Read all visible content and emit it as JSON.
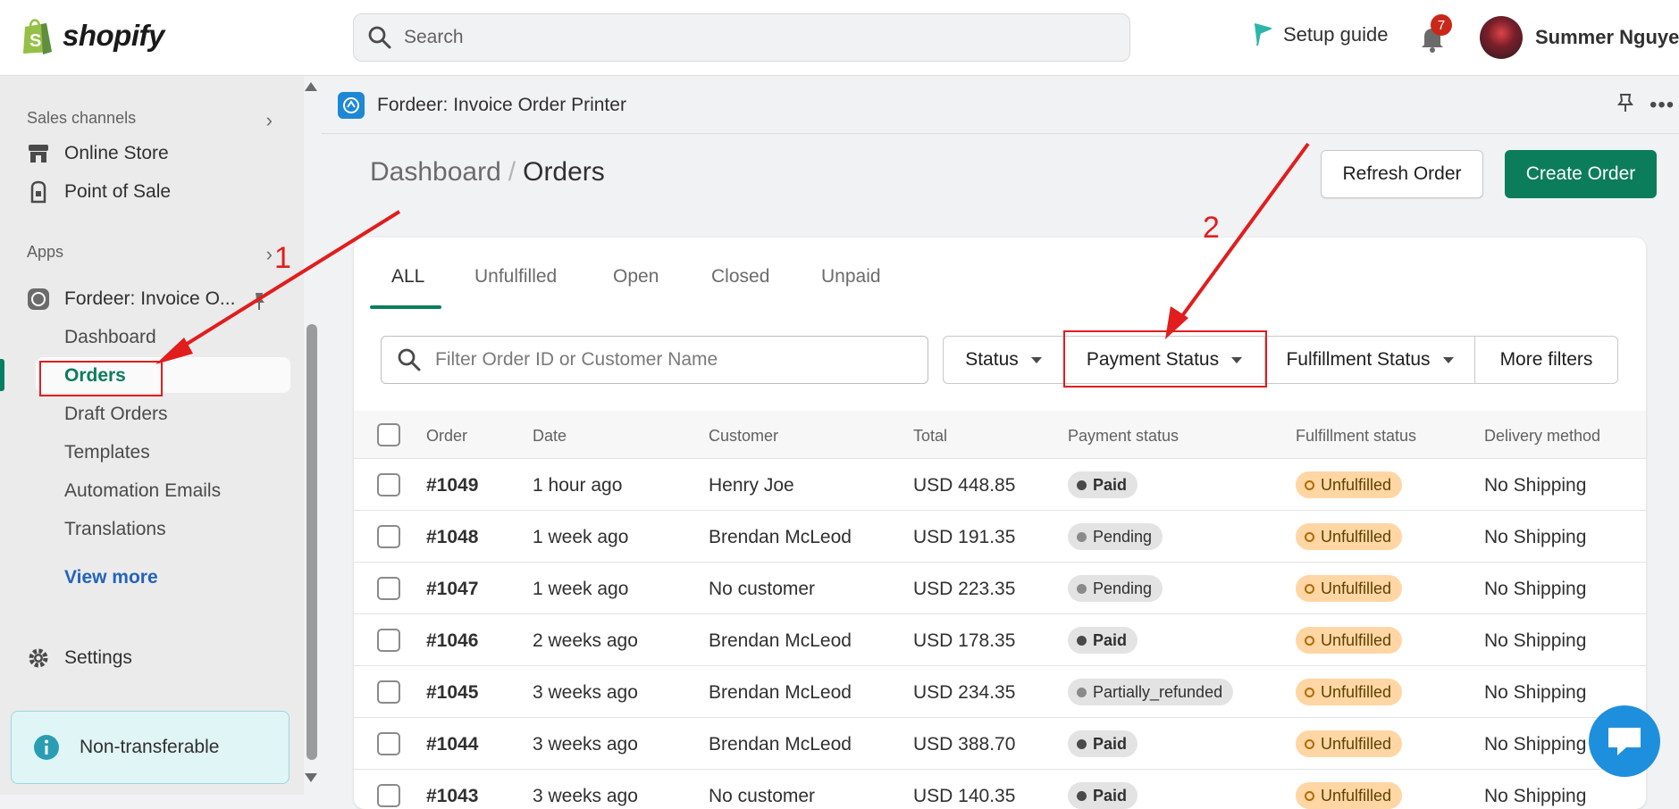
{
  "topbar": {
    "brand": "shopify",
    "search_placeholder": "Search",
    "setup_guide": "Setup guide",
    "notification_count": "7",
    "user_name": "Summer Nguyen"
  },
  "sidebar": {
    "sales_channels": "Sales channels",
    "online_store": "Online Store",
    "point_of_sale": "Point of Sale",
    "apps": "Apps",
    "app_name": "Fordeer: Invoice O...",
    "sub_items": [
      "Dashboard",
      "Orders",
      "Draft Orders",
      "Templates",
      "Automation Emails",
      "Translations"
    ],
    "view_more": "View more",
    "settings": "Settings",
    "banner": "Non-transferable"
  },
  "app": {
    "title": "Fordeer: Invoice Order Printer",
    "breadcrumb_parent": "Dashboard",
    "breadcrumb_sep": "/",
    "page_title": "Orders",
    "refresh_button": "Refresh Order",
    "create_button": "Create Order"
  },
  "tabs": [
    "ALL",
    "Unfulfilled",
    "Open",
    "Closed",
    "Unpaid"
  ],
  "filters": {
    "search_placeholder": "Filter Order ID or Customer Name",
    "status": "Status",
    "payment_status": "Payment Status",
    "fulfillment_status": "Fulfillment Status",
    "more_filters": "More filters"
  },
  "table": {
    "columns": [
      "Order",
      "Date",
      "Customer",
      "Total",
      "Payment status",
      "Fulfillment status",
      "Delivery method"
    ],
    "rows": [
      {
        "order": "#1049",
        "date": "1 hour ago",
        "customer": "Henry Joe",
        "total": "USD 448.85",
        "payment": "Paid",
        "fulfillment": "Unfulfilled",
        "delivery": "No Shipping"
      },
      {
        "order": "#1048",
        "date": "1 week ago",
        "customer": "Brendan McLeod",
        "total": "USD 191.35",
        "payment": "Pending",
        "fulfillment": "Unfulfilled",
        "delivery": "No Shipping"
      },
      {
        "order": "#1047",
        "date": "1 week ago",
        "customer": "No customer",
        "total": "USD 223.35",
        "payment": "Pending",
        "fulfillment": "Unfulfilled",
        "delivery": "No Shipping"
      },
      {
        "order": "#1046",
        "date": "2 weeks ago",
        "customer": "Brendan McLeod",
        "total": "USD 178.35",
        "payment": "Paid",
        "fulfillment": "Unfulfilled",
        "delivery": "No Shipping"
      },
      {
        "order": "#1045",
        "date": "3 weeks ago",
        "customer": "Brendan McLeod",
        "total": "USD 234.35",
        "payment": "Partially_refunded",
        "fulfillment": "Unfulfilled",
        "delivery": "No Shipping"
      },
      {
        "order": "#1044",
        "date": "3 weeks ago",
        "customer": "Brendan McLeod",
        "total": "USD 388.70",
        "payment": "Paid",
        "fulfillment": "Unfulfilled",
        "delivery": "No Shipping"
      },
      {
        "order": "#1043",
        "date": "3 weeks ago",
        "customer": "No customer",
        "total": "USD 140.35",
        "payment": "Paid",
        "fulfillment": "Unfulfilled",
        "delivery": "No Shipping"
      }
    ]
  },
  "annotations": {
    "step1": "1",
    "step2": "2"
  },
  "colors": {
    "accent": "#0b7d5a",
    "annotation": "#e11d1d",
    "brand": "#95bf47"
  },
  "icons": [
    "shopify-bag-icon",
    "search-icon",
    "flag-icon",
    "bell-icon",
    "store-icon",
    "pos-icon",
    "chevron-right-icon",
    "app-icon",
    "pin-icon",
    "gear-icon",
    "info-icon",
    "chat-icon"
  ]
}
